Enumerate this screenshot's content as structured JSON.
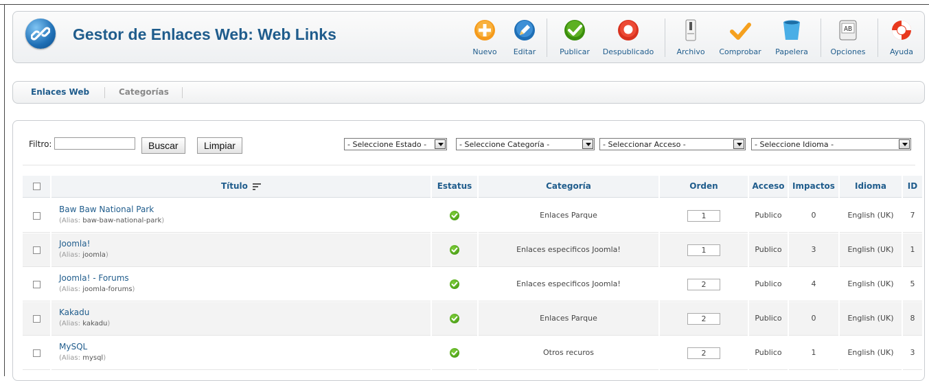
{
  "header": {
    "title": "Gestor de Enlaces Web: Web Links",
    "toolbar": [
      {
        "name": "new-button",
        "icon": "plus-icon",
        "label": "Nuevo"
      },
      {
        "name": "edit-button",
        "icon": "pencil-icon",
        "label": "Editar"
      },
      {
        "name": "publish-button",
        "icon": "check-icon",
        "label": "Publicar"
      },
      {
        "name": "unpublish-button",
        "icon": "unpublish-icon",
        "label": "Despublicado"
      },
      {
        "name": "archive-button",
        "icon": "archive-icon",
        "label": "Archivo"
      },
      {
        "name": "checkin-button",
        "icon": "checkmark-icon",
        "label": "Comprobar"
      },
      {
        "name": "trash-button",
        "icon": "trash-icon",
        "label": "Papelera"
      },
      {
        "name": "options-button",
        "icon": "options-icon",
        "label": "Opciones"
      },
      {
        "name": "help-button",
        "icon": "lifebuoy-icon",
        "label": "Ayuda"
      }
    ]
  },
  "tabs": [
    {
      "label": "Enlaces Web",
      "active": true
    },
    {
      "label": "Categorías",
      "active": false
    }
  ],
  "filter": {
    "label": "Filtro:",
    "value": "",
    "search_label": "Buscar",
    "clear_label": "Limpiar",
    "selects": {
      "state": "- Seleccione Estado -",
      "category": "- Seleccione Categoría -",
      "access": "- Seleccionar Acceso -",
      "language": "- Seleccione Idioma -"
    }
  },
  "table": {
    "headers": {
      "title": "Título",
      "status": "Estatus",
      "category": "Categoría",
      "order": "Orden",
      "access": "Acceso",
      "hits": "Impactos",
      "language": "Idioma",
      "id": "ID"
    },
    "alias_prefix": "Alias",
    "rows": [
      {
        "title": "Baw Baw National Park",
        "alias": "baw-baw-national-park",
        "published": true,
        "category": "Enlaces Parque",
        "order": "1",
        "access": "Publico",
        "hits": "0",
        "language": "English (UK)",
        "id": "7"
      },
      {
        "title": "Joomla!",
        "alias": "joomla",
        "published": true,
        "category": "Enlaces especificos Joomla!",
        "order": "1",
        "access": "Publico",
        "hits": "3",
        "language": "English (UK)",
        "id": "1"
      },
      {
        "title": "Joomla! - Forums",
        "alias": "joomla-forums",
        "published": true,
        "category": "Enlaces especificos Joomla!",
        "order": "2",
        "access": "Publico",
        "hits": "4",
        "language": "English (UK)",
        "id": "5"
      },
      {
        "title": "Kakadu",
        "alias": "kakadu",
        "published": true,
        "category": "Enlaces Parque",
        "order": "2",
        "access": "Publico",
        "hits": "0",
        "language": "English (UK)",
        "id": "8"
      },
      {
        "title": "MySQL",
        "alias": "mysql",
        "published": true,
        "category": "Otros recuros",
        "order": "2",
        "access": "Publico",
        "hits": "1",
        "language": "English (UK)",
        "id": "3"
      }
    ]
  },
  "colors": {
    "title_blue": "#1f5c8c",
    "published_green": "#3a8e0c",
    "header_bg": "#f2f4f6"
  }
}
